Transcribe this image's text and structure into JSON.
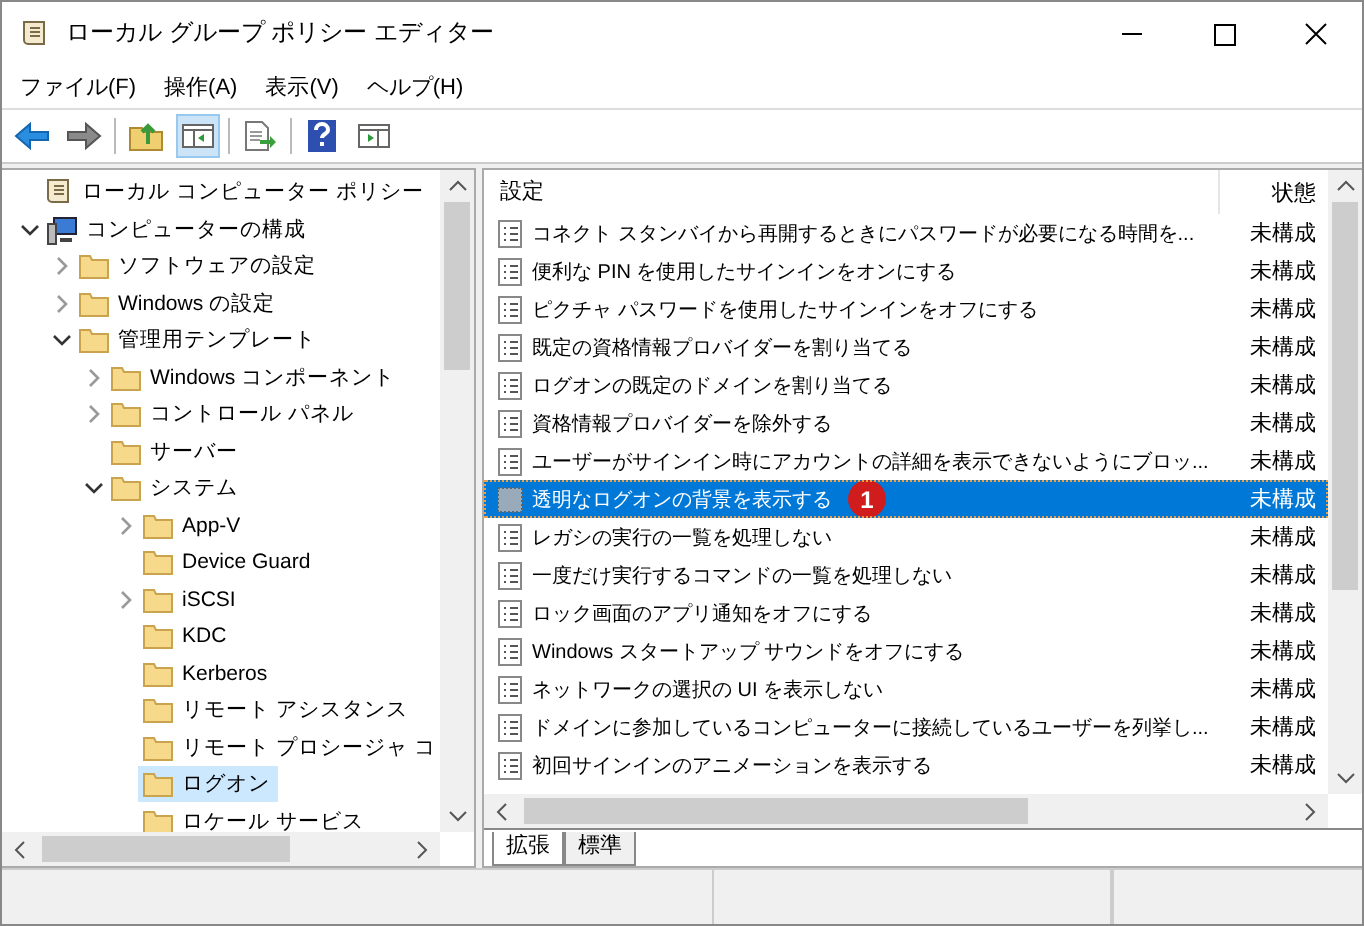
{
  "window": {
    "title": "ローカル グループ ポリシー エディター"
  },
  "menu": [
    "ファイル(F)",
    "操作(A)",
    "表示(V)",
    "ヘルプ(H)"
  ],
  "toolbar": [
    [
      {
        "kind": "back",
        "selected": false
      },
      {
        "kind": "forward",
        "selected": false
      }
    ],
    [
      {
        "kind": "up",
        "selected": false
      },
      {
        "kind": "pane",
        "selected": true
      }
    ],
    [
      {
        "kind": "export",
        "selected": false
      }
    ],
    [
      {
        "kind": "help",
        "selected": false
      },
      {
        "kind": "view",
        "selected": false
      }
    ]
  ],
  "tree": [
    {
      "label": "ローカル コンピューター ポリシー",
      "selected": false,
      "children": [
        {
          "label": "コンピューターの構成",
          "expanded": true,
          "selected": false,
          "children": [
            {
              "label": "ソフトウェアの設定",
              "expanded": false,
              "selected": false
            },
            {
              "label": "Windows の設定",
              "expanded": false,
              "selected": false
            },
            {
              "label": "管理用テンプレート",
              "expanded": true,
              "selected": false,
              "children": [
                {
                  "label": "Windows コンポーネント",
                  "expanded": false,
                  "selected": false
                },
                {
                  "label": "コントロール パネル",
                  "expanded": false,
                  "selected": false
                },
                {
                  "label": "サーバー",
                  "selected": false
                },
                {
                  "label": "システム",
                  "expanded": true,
                  "selected": false,
                  "children": [
                    {
                      "label": "App-V",
                      "expanded": false,
                      "selected": false
                    },
                    {
                      "label": "Device Guard",
                      "selected": false
                    },
                    {
                      "label": "iSCSI",
                      "expanded": false,
                      "selected": false
                    },
                    {
                      "label": "KDC",
                      "selected": false
                    },
                    {
                      "label": "Kerberos",
                      "selected": false
                    },
                    {
                      "label": "リモート アシスタンス",
                      "selected": false
                    },
                    {
                      "label": "リモート プロシージャ コ",
                      "selected": false
                    },
                    {
                      "label": "ログオン",
                      "selected": true
                    },
                    {
                      "label": "ロケール サービス",
                      "selected": false
                    }
                  ]
                }
              ]
            }
          ]
        }
      ]
    }
  ],
  "list": {
    "columns": [
      "設定",
      "状態"
    ],
    "rows": [
      {
        "setting": "コネクト スタンバイから再開するときにパスワードが必要になる時間を...",
        "state": "未構成",
        "selected": false
      },
      {
        "setting": "便利な PIN を使用したサインインをオンにする",
        "state": "未構成",
        "selected": false
      },
      {
        "setting": "ピクチャ パスワードを使用したサインインをオフにする",
        "state": "未構成",
        "selected": false
      },
      {
        "setting": "既定の資格情報プロバイダーを割り当てる",
        "state": "未構成",
        "selected": false
      },
      {
        "setting": "ログオンの既定のドメインを割り当てる",
        "state": "未構成",
        "selected": false
      },
      {
        "setting": "資格情報プロバイダーを除外する",
        "state": "未構成",
        "selected": false
      },
      {
        "setting": "ユーザーがサインイン時にアカウントの詳細を表示できないようにブロッ...",
        "state": "未構成",
        "selected": false
      },
      {
        "setting": "透明なログオンの背景を表示する",
        "state": "未構成",
        "selected": true,
        "badge": "1"
      },
      {
        "setting": "レガシの実行の一覧を処理しない",
        "state": "未構成",
        "selected": false
      },
      {
        "setting": "一度だけ実行するコマンドの一覧を処理しない",
        "state": "未構成",
        "selected": false
      },
      {
        "setting": "ロック画面のアプリ通知をオフにする",
        "state": "未構成",
        "selected": false
      },
      {
        "setting": "Windows スタートアップ サウンドをオフにする",
        "state": "未構成",
        "selected": false
      },
      {
        "setting": "ネットワークの選択の UI を表示しない",
        "state": "未構成",
        "selected": false
      },
      {
        "setting": "ドメインに参加しているコンピューターに接続しているユーザーを列挙し...",
        "state": "未構成",
        "selected": false
      },
      {
        "setting": "初回サインインのアニメーションを表示する",
        "state": "未構成",
        "selected": false
      }
    ]
  },
  "tabs": [
    {
      "label": "拡張",
      "selected": true
    },
    {
      "label": "標準",
      "selected": false
    }
  ]
}
